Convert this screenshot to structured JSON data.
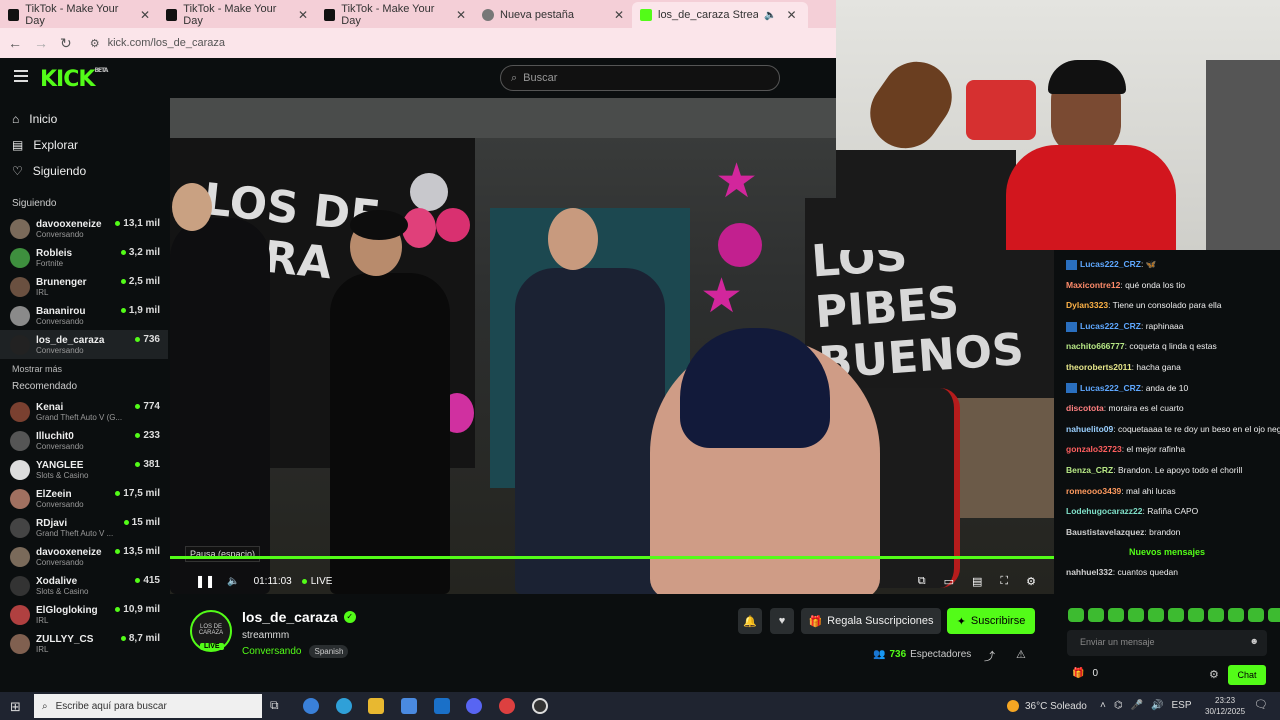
{
  "browser": {
    "tabs": [
      {
        "title": "TikTok - Make Your Day",
        "icon": "tiktok-icon"
      },
      {
        "title": "TikTok - Make Your Day",
        "icon": "tiktok-icon"
      },
      {
        "title": "TikTok - Make Your Day",
        "icon": "tiktok-icon"
      },
      {
        "title": "Nueva pestaña",
        "icon": "newtab-icon"
      },
      {
        "title": "los_de_caraza Stream - Wat",
        "icon": "kick-icon",
        "active": true
      }
    ],
    "url": "kick.com/los_de_caraza"
  },
  "header": {
    "logo": "KICK",
    "logo_sup": "BETA",
    "search_placeholder": "Buscar"
  },
  "sidebar": {
    "nav": [
      {
        "label": "Inicio",
        "icon": "home-icon"
      },
      {
        "label": "Explorar",
        "icon": "compass-icon"
      },
      {
        "label": "Siguiendo",
        "icon": "heart-icon"
      }
    ],
    "following_title": "Siguiendo",
    "following": [
      {
        "name": "davooxeneize",
        "category": "Conversando",
        "viewers": "13,1 mil",
        "color": "#7a6a5a"
      },
      {
        "name": "Robleis",
        "category": "Fortnite",
        "viewers": "3,2 mil",
        "color": "#3e8f3e"
      },
      {
        "name": "Brunenger",
        "category": "IRL",
        "viewers": "2,5 mil",
        "color": "#6a5040"
      },
      {
        "name": "Bananirou",
        "category": "Conversando",
        "viewers": "1,9 mil",
        "color": "#8a8a8a"
      },
      {
        "name": "los_de_caraza",
        "category": "Conversando",
        "viewers": "736",
        "color": "#222",
        "active": true
      }
    ],
    "show_more": "Mostrar más",
    "recommended_title": "Recomendado",
    "recommended": [
      {
        "name": "Kenai",
        "category": "Grand Theft Auto V (G...",
        "viewers": "774",
        "color": "#7a4030"
      },
      {
        "name": "Illuchit0",
        "category": "Conversando",
        "viewers": "233",
        "color": "#555"
      },
      {
        "name": "YANGLEE",
        "category": "Slots & Casino",
        "viewers": "381",
        "color": "#ddd"
      },
      {
        "name": "ElZeein",
        "category": "Conversando",
        "viewers": "17,5 mil",
        "color": "#a07060"
      },
      {
        "name": "RDjavi",
        "category": "Grand Theft Auto V ...",
        "viewers": "15 mil",
        "color": "#444"
      },
      {
        "name": "davooxeneize",
        "category": "Conversando",
        "viewers": "13,5 mil",
        "color": "#7a6a5a"
      },
      {
        "name": "Xodalive",
        "category": "Slots & Casino",
        "viewers": "415",
        "color": "#333"
      },
      {
        "name": "ElGlogloking",
        "category": "IRL",
        "viewers": "10,9 mil",
        "color": "#b04040"
      },
      {
        "name": "ZULLYY_CS",
        "category": "IRL",
        "viewers": "8,7 mil",
        "color": "#806050"
      }
    ]
  },
  "video": {
    "tooltip": "Pausa (espacio)",
    "time": "01:11:03",
    "live_label": "LIVE",
    "banner_left": "LOS DE CARA",
    "banner_right": "LOS PIBES BUENOS"
  },
  "stream": {
    "channel": "los_de_caraza",
    "title": "streammm",
    "category": "Conversando",
    "language": "Spanish",
    "avatar_text": "LOS DE CARAZA",
    "live_badge": "LIVE",
    "viewers": "736",
    "viewers_label": "Espectadores",
    "gift_label": "Regala Suscripciones",
    "subscribe_label": "Suscribirse"
  },
  "chat": {
    "messages": [
      {
        "user": "Lucas222_CRZ",
        "text": "🦋",
        "color": "#5fa8ff",
        "badge": true
      },
      {
        "user": "Maxicontre12",
        "text": "qué onda los tio",
        "color": "#ff8c6b"
      },
      {
        "user": "Dylan3323",
        "text": "Tiene un consolado para ella",
        "color": "#ffb347"
      },
      {
        "user": "Lucas222_CRZ",
        "text": "raphinaaa",
        "color": "#5fa8ff",
        "badge": true
      },
      {
        "user": "nachito666777",
        "text": "coqueta q linda q estas",
        "color": "#b8e986"
      },
      {
        "user": "theoroberts2011",
        "text": "hacha gana",
        "color": "#e6e68a"
      },
      {
        "user": "Lucas222_CRZ",
        "text": "anda de 10",
        "color": "#5fa8ff",
        "badge": true
      },
      {
        "user": "discotota",
        "text": "moraira es el cuarto",
        "color": "#ff8080"
      },
      {
        "user": "nahuelito09",
        "text": "coquetaaaa te re doy un beso en el ojo negro",
        "color": "#9ad0ff"
      },
      {
        "user": "gonzalo32723",
        "text": "el mejor rafinha",
        "color": "#ff5f5f"
      },
      {
        "user": "Benza_CRZ",
        "text": "Brandon. Le apoyo todo el chorill",
        "color": "#b8e986"
      },
      {
        "user": "romeooo3439",
        "text": "mal ahi lucas",
        "color": "#ff9a5f"
      },
      {
        "user": "Lodehugocarazz22",
        "text": "Rafiña CAPO",
        "color": "#7fe0c8"
      },
      {
        "user": "Baustistavelazquez",
        "text": "brandon",
        "color": "#d0d0d0"
      }
    ],
    "new_messages": "Nuevos mensajes",
    "after_messages": [
      {
        "user": "nahhuel332",
        "text": "cuantos quedan",
        "color": "#d0d0d0"
      }
    ],
    "input_placeholder": "Enviar un mensaje",
    "points": "0",
    "chat_button": "Chat"
  },
  "taskbar": {
    "search_placeholder": "Escribe aquí para buscar",
    "weather": "36°C  Soleado",
    "lang": "ESP",
    "time": "23:23",
    "date": "30/12/2025"
  }
}
